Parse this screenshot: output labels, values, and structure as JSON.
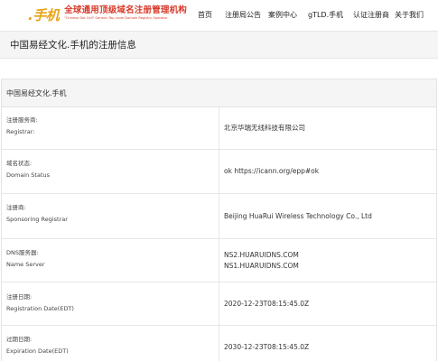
{
  "header": {
    "logo_mark": ".手机",
    "logo_cn": "全球通用顶级域名注册管理机构",
    "logo_en": "\"Chinese Dot Cell\" Generic Top Level Domain Registry Operator",
    "nav": [
      "首页",
      "注册局公告",
      "案例中心",
      "gTLD.手机",
      "认证注册商",
      "关于我们"
    ]
  },
  "page_title": "中国易经文化.手机的注册信息",
  "card": {
    "heading": "中国易经文化.手机",
    "rows": [
      {
        "label_cn": "注册服务商:",
        "label_en": "Registrar:",
        "value": [
          "北京华瑞无线科技有限公司"
        ]
      },
      {
        "label_cn": "域名状态:",
        "label_en": "Domain Status",
        "value": [
          "ok https://icann.org/epp#ok"
        ]
      },
      {
        "label_cn": "注册商:",
        "label_en": "Sponsoring Registrar",
        "value": [
          "Beijing HuaRui Wireless Technology Co., Ltd"
        ]
      },
      {
        "label_cn": "DNS服务器:",
        "label_en": "Name Server",
        "value": [
          "NS2.HUARUIDNS.COM",
          "NS1.HUARUIDNS.COM"
        ]
      },
      {
        "label_cn": "注册日期:",
        "label_en": "Registration Date(EDT)",
        "value": [
          "2020-12-23T08:15:45.0Z"
        ]
      },
      {
        "label_cn": "过期日期:",
        "label_en": "Expiration Date(EDT)",
        "value": [
          "2030-12-23T08:15:45.0Z"
        ]
      }
    ]
  }
}
